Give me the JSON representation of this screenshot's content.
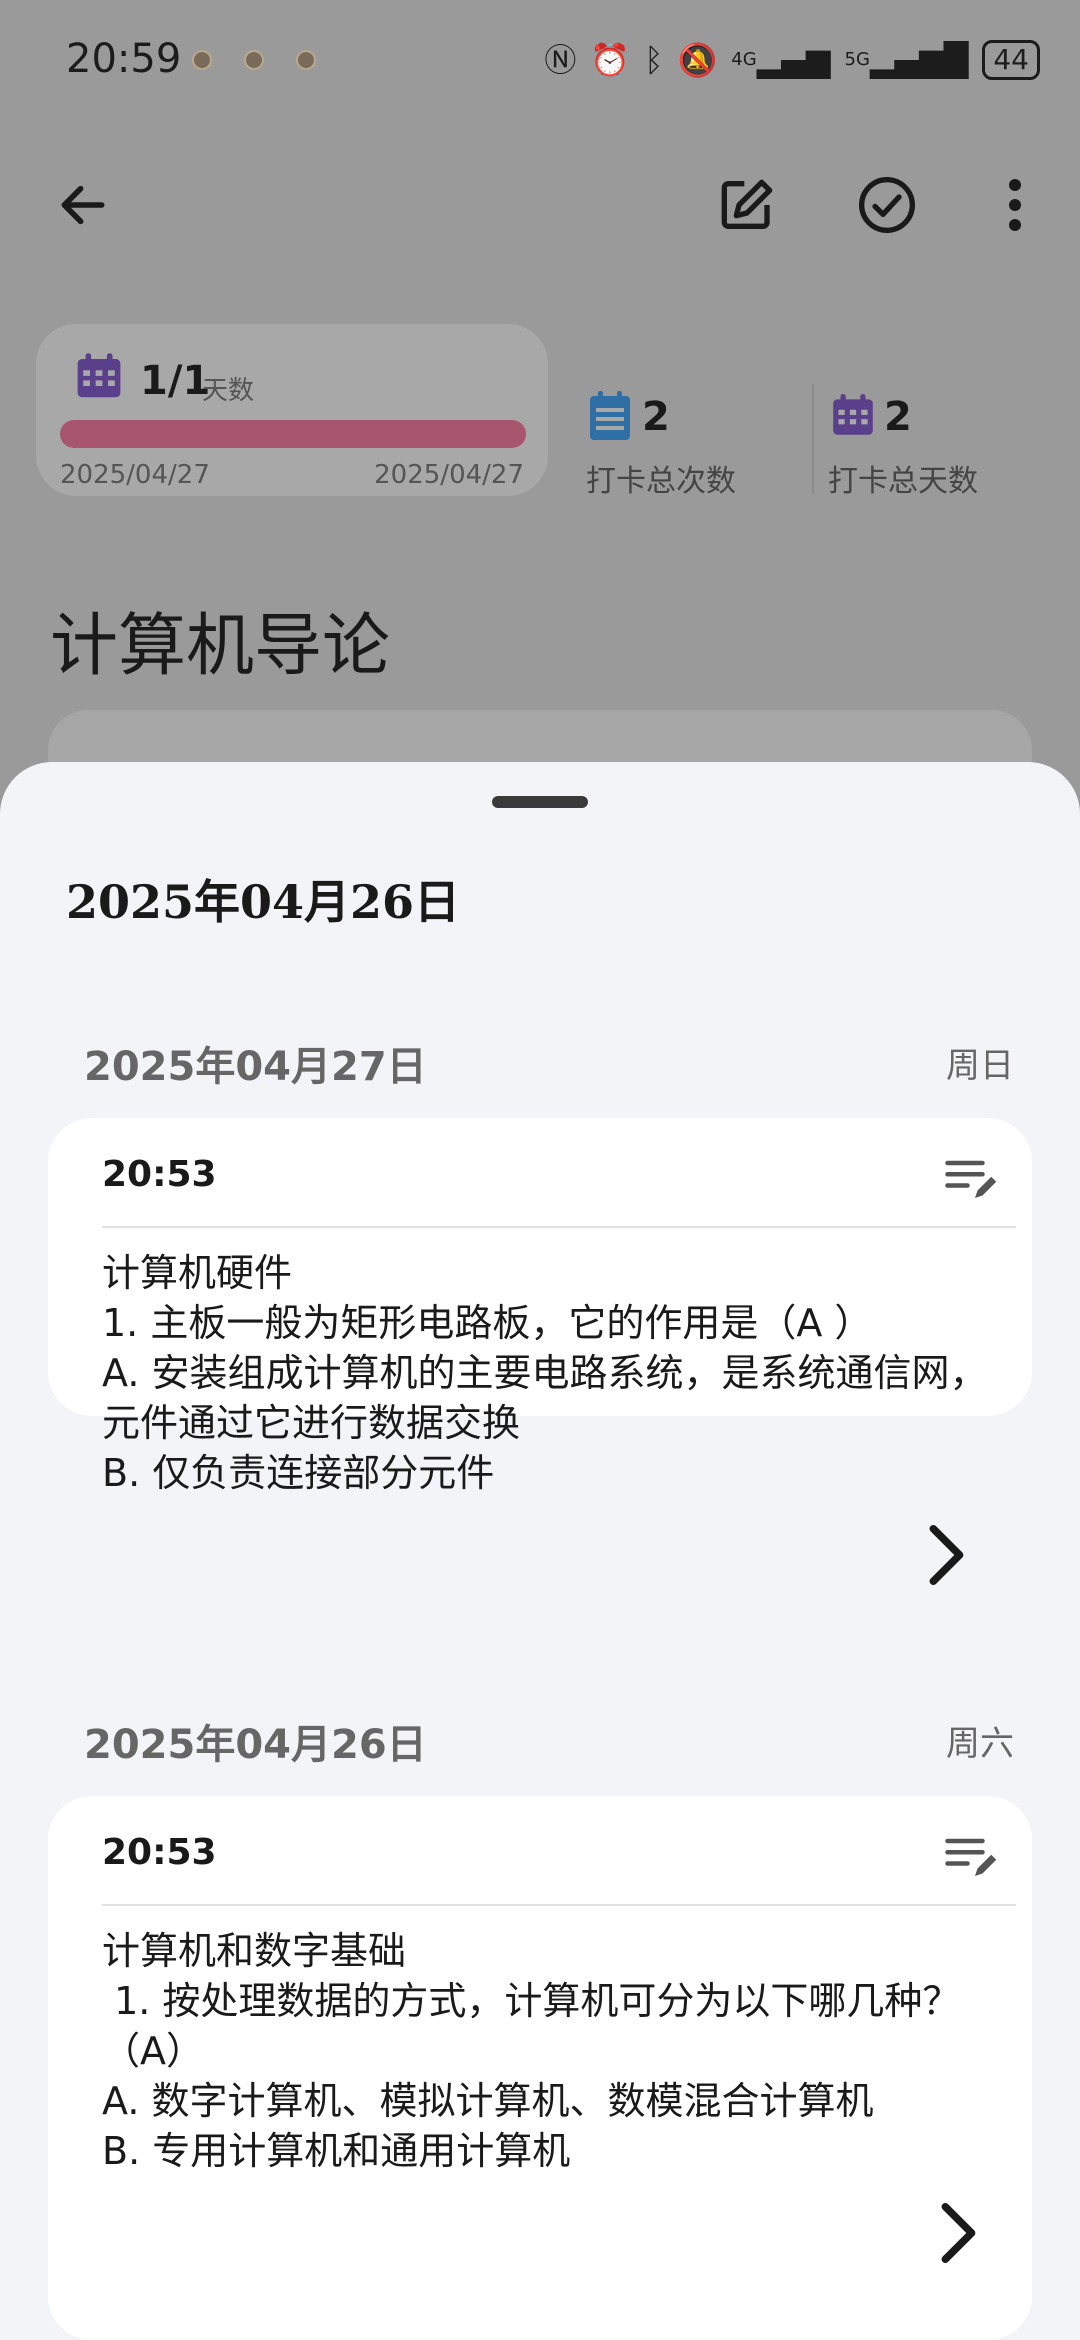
{
  "status_bar": {
    "time": "20:59",
    "battery": "44",
    "network_1": "4G",
    "network_2": "5G"
  },
  "stats": {
    "range_count": "1/1",
    "range_unit": "天数",
    "range_progress": 1.0,
    "range_start": "2025/04/27",
    "range_end": "2025/04/27",
    "checkin_count": "2",
    "checkin_count_label": "打卡总次数",
    "checkin_days": "2",
    "checkin_days_label": "打卡总天数"
  },
  "page_title": "计算机导论",
  "sheet": {
    "title": "2025年04月26日",
    "days": [
      {
        "date": "2025年04月27日",
        "weekday": "周日",
        "entry": {
          "time": "20:53",
          "text": "计算机硬件\n1. 主板一般为矩形电路板，它的作用是（A ）\nA. 安装组成计算机的主要电路系统，是系统通信网，元件通过它进行数据交换\nB. 仅负责连接部分元件"
        }
      },
      {
        "date": "2025年04月26日",
        "weekday": "周六",
        "entry": {
          "time": "20:53",
          "text": "计算机和数字基础\n 1. 按处理数据的方式，计算机可分为以下哪几种？（A）\nA. 数字计算机、模拟计算机、数模混合计算机\nB. 专用计算机和通用计算机"
        }
      }
    ]
  },
  "colors": {
    "accent_progress": "#a8566e",
    "calendar_purple": "#5a3f8a",
    "list_blue": "#2f6fa6"
  },
  "icons": {
    "back": "arrow-left-icon",
    "edit": "edit-icon",
    "done": "check-circle-icon",
    "more": "more-vert-icon",
    "calendar": "calendar-icon",
    "list": "list-icon",
    "entry_edit": "notes-edit-icon",
    "open": "chevron-right-icon"
  }
}
